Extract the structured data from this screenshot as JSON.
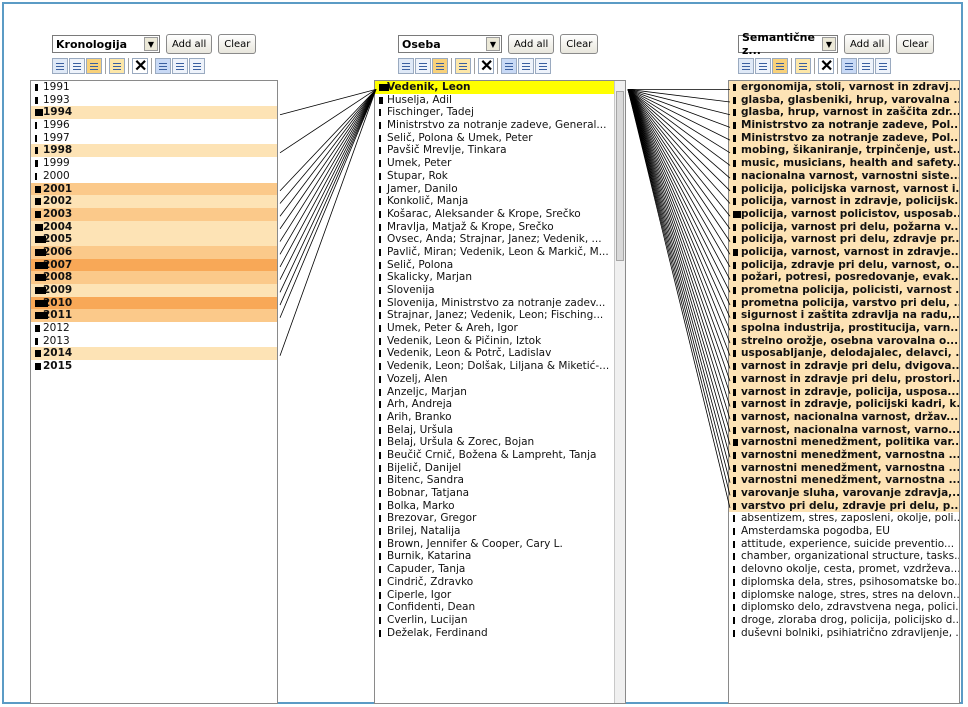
{
  "common": {
    "add_all": "Add all",
    "clear": "Clear"
  },
  "panels": [
    {
      "dropdown": "Kronologija"
    },
    {
      "dropdown": "Oseba"
    },
    {
      "dropdown": "Semantične z..."
    }
  ],
  "lists": {
    "years": [
      {
        "t": "1991",
        "w": 3,
        "h": ""
      },
      {
        "t": "1993",
        "w": 3,
        "h": ""
      },
      {
        "t": "1994",
        "w": 8,
        "h": "hl1",
        "b": true
      },
      {
        "t": "1996",
        "w": 2,
        "h": ""
      },
      {
        "t": "1997",
        "w": 2,
        "h": ""
      },
      {
        "t": "1998",
        "w": 3,
        "h": "hl1",
        "b": true
      },
      {
        "t": "1999",
        "w": 3,
        "h": ""
      },
      {
        "t": "2000",
        "w": 2,
        "h": ""
      },
      {
        "t": "2001",
        "w": 6,
        "h": "hl2",
        "b": true
      },
      {
        "t": "2002",
        "w": 6,
        "h": "hl1",
        "b": true
      },
      {
        "t": "2003",
        "w": 6,
        "h": "hl2",
        "b": true
      },
      {
        "t": "2004",
        "w": 8,
        "h": "hl1",
        "b": true
      },
      {
        "t": "2005",
        "w": 11,
        "h": "hl1",
        "b": true
      },
      {
        "t": "2006",
        "w": 11,
        "h": "hl2",
        "b": true
      },
      {
        "t": "2007",
        "w": 13,
        "h": "hl3",
        "b": true
      },
      {
        "t": "2008",
        "w": 11,
        "h": "hl2",
        "b": true
      },
      {
        "t": "2009",
        "w": 11,
        "h": "hl1",
        "b": true
      },
      {
        "t": "2010",
        "w": 13,
        "h": "hl3",
        "b": true
      },
      {
        "t": "2011",
        "w": 13,
        "h": "hl2",
        "b": true
      },
      {
        "t": "2012",
        "w": 5,
        "h": ""
      },
      {
        "t": "2013",
        "w": 3,
        "h": ""
      },
      {
        "t": "2014",
        "w": 6,
        "h": "hl1",
        "b": true
      },
      {
        "t": "2015",
        "w": 6,
        "h": "",
        "b": true
      }
    ],
    "people": [
      {
        "t": "Vedenik, Leon",
        "w": 10,
        "h": "hlY",
        "b": true
      },
      {
        "t": "Huselja, Adil",
        "w": 4,
        "h": ""
      },
      {
        "t": "Fischinger, Tadej",
        "w": 2,
        "h": ""
      },
      {
        "t": "Ministrstvo za notranje zadeve, General...",
        "w": 2,
        "h": ""
      },
      {
        "t": "Selič, Polona & Umek, Peter",
        "w": 2,
        "h": ""
      },
      {
        "t": "Pavšič Mrevlje, Tinkara",
        "w": 2,
        "h": ""
      },
      {
        "t": "Umek, Peter",
        "w": 2,
        "h": ""
      },
      {
        "t": "Štupar, Rok",
        "w": 2,
        "h": ""
      },
      {
        "t": "Jamer, Danilo",
        "w": 2,
        "h": ""
      },
      {
        "t": "Konkolič, Manja",
        "w": 2,
        "h": ""
      },
      {
        "t": "Košarac, Aleksander & Krope, Srečko",
        "w": 2,
        "h": ""
      },
      {
        "t": "Mravlja, Matjaž & Krope, Srečko",
        "w": 2,
        "h": ""
      },
      {
        "t": "Ovsec, Anda; Strajnar, Janez; Vedenik, ...",
        "w": 2,
        "h": ""
      },
      {
        "t": "Pavlič, Miran; Vedenik, Leon & Markič, M...",
        "w": 2,
        "h": ""
      },
      {
        "t": "Selič, Polona",
        "w": 2,
        "h": ""
      },
      {
        "t": "Skalicky, Marjan",
        "w": 2,
        "h": ""
      },
      {
        "t": "Slovenija",
        "w": 2,
        "h": ""
      },
      {
        "t": "Slovenija, Ministrstvo za notranje zadev...",
        "w": 2,
        "h": ""
      },
      {
        "t": "Strajnar, Janez; Vedenik, Leon; Fisching...",
        "w": 2,
        "h": ""
      },
      {
        "t": "Umek, Peter & Areh, Igor",
        "w": 2,
        "h": ""
      },
      {
        "t": "Vedenik, Leon & Pičinin, Iztok",
        "w": 2,
        "h": ""
      },
      {
        "t": "Vedenik, Leon & Potrč, Ladislav",
        "w": 2,
        "h": ""
      },
      {
        "t": "Vedenik, Leon; Dolšak, Liljana & Miketić-...",
        "w": 2,
        "h": ""
      },
      {
        "t": "Vozelj, Alen",
        "w": 2,
        "h": ""
      },
      {
        "t": "Anzeljc, Marjan",
        "w": 2,
        "h": ""
      },
      {
        "t": "Arh, Andreja",
        "w": 2,
        "h": ""
      },
      {
        "t": "Arih, Branko",
        "w": 2,
        "h": ""
      },
      {
        "t": "Belaj, Uršula",
        "w": 2,
        "h": ""
      },
      {
        "t": "Belaj, Uršula & Zorec, Bojan",
        "w": 2,
        "h": ""
      },
      {
        "t": "Beučič Crnič, Božena & Lampreht, Tanja",
        "w": 2,
        "h": ""
      },
      {
        "t": "Bijelič, Danijel",
        "w": 2,
        "h": ""
      },
      {
        "t": "Bitenc, Sandra",
        "w": 2,
        "h": ""
      },
      {
        "t": "Bobnar, Tatjana",
        "w": 2,
        "h": ""
      },
      {
        "t": "Bolka, Marko",
        "w": 2,
        "h": ""
      },
      {
        "t": "Brezovar, Gregor",
        "w": 2,
        "h": ""
      },
      {
        "t": "Brilej, Natalija",
        "w": 2,
        "h": ""
      },
      {
        "t": "Brown, Jennifer & Cooper, Cary L.",
        "w": 2,
        "h": ""
      },
      {
        "t": "Burnik, Katarina",
        "w": 2,
        "h": ""
      },
      {
        "t": "Capuder, Tanja",
        "w": 2,
        "h": ""
      },
      {
        "t": "Cindrič, Zdravko",
        "w": 2,
        "h": ""
      },
      {
        "t": "Ciperle, Igor",
        "w": 2,
        "h": ""
      },
      {
        "t": "Confidenti, Dean",
        "w": 2,
        "h": ""
      },
      {
        "t": "Cverlin, Lucijan",
        "w": 2,
        "h": ""
      },
      {
        "t": "Deželak, Ferdinand",
        "w": 2,
        "h": ""
      }
    ],
    "topics": [
      {
        "t": "ergonomija, stoli, varnost in zdravj...",
        "w": 3,
        "h": "hl1",
        "b": true
      },
      {
        "t": "glasba, glasbeniki, hrup, varovalna ...",
        "w": 3,
        "h": "hl1",
        "b": true
      },
      {
        "t": "glasba, hrup, varnost in zaščita zdr...",
        "w": 3,
        "h": "hl1",
        "b": true
      },
      {
        "t": "Ministrstvo za notranje zadeve, Pol...",
        "w": 3,
        "h": "hl1",
        "b": true
      },
      {
        "t": "Ministrstvo za notranje zadeve, Pol...",
        "w": 3,
        "h": "hl1",
        "b": true
      },
      {
        "t": "mobing, šikaniranje, trpinčenje, ust...",
        "w": 3,
        "h": "hl1",
        "b": true
      },
      {
        "t": "music, musicians, health and safety...",
        "w": 3,
        "h": "hl1",
        "b": true
      },
      {
        "t": "nacionalna varnost, varnostni siste...",
        "w": 3,
        "h": "hl1",
        "b": true
      },
      {
        "t": "policija, policijska varnost, varnost i...",
        "w": 3,
        "h": "hl1",
        "b": true
      },
      {
        "t": "policija, varnost in zdravje, policijsk...",
        "w": 3,
        "h": "hl1",
        "b": true
      },
      {
        "t": "policija, varnost policistov, usposab...",
        "w": 8,
        "h": "hl1",
        "b": true
      },
      {
        "t": "policija, varnost pri delu, požarna v...",
        "w": 3,
        "h": "hl1",
        "b": true
      },
      {
        "t": "policija, varnost pri delu, zdravje pr...",
        "w": 3,
        "h": "hl1",
        "b": true
      },
      {
        "t": "policija, varnost, varnost in zdravje...",
        "w": 5,
        "h": "hl1",
        "b": true
      },
      {
        "t": "policija, zdravje pri delu, varnost, o...",
        "w": 3,
        "h": "hl1",
        "b": true
      },
      {
        "t": "požari, potresi, posredovanje, evak...",
        "w": 3,
        "h": "hl1",
        "b": true
      },
      {
        "t": "prometna policija, policisti, varnost ...",
        "w": 3,
        "h": "hl1",
        "b": true
      },
      {
        "t": "prometna policija, varstvo pri delu, ...",
        "w": 3,
        "h": "hl1",
        "b": true
      },
      {
        "t": "sigurnost i zaštita zdravlja na radu,...",
        "w": 3,
        "h": "hl1",
        "b": true
      },
      {
        "t": "spolna industrija, prostitucija, varn...",
        "w": 3,
        "h": "hl1",
        "b": true
      },
      {
        "t": "strelno orožje, osebna varovalna o...",
        "w": 3,
        "h": "hl1",
        "b": true
      },
      {
        "t": "usposabljanje, delodajalec, delavci, ...",
        "w": 3,
        "h": "hl1",
        "b": true
      },
      {
        "t": "varnost in zdravje pri delu, dvigova...",
        "w": 3,
        "h": "hl1",
        "b": true
      },
      {
        "t": "varnost in zdravje pri delu, prostori...",
        "w": 3,
        "h": "hl1",
        "b": true
      },
      {
        "t": "varnost in zdravje, policija, usposa...",
        "w": 3,
        "h": "hl1",
        "b": true
      },
      {
        "t": "varnost in zdravje, policijski kadri, k...",
        "w": 3,
        "h": "hl1",
        "b": true
      },
      {
        "t": "varnost, nacionalna varnost, držav...",
        "w": 3,
        "h": "hl1",
        "b": true
      },
      {
        "t": "varnost, nacionalna varnost, varno...",
        "w": 3,
        "h": "hl1",
        "b": true
      },
      {
        "t": "varnostni menedžment, politika var...",
        "w": 5,
        "h": "hl1",
        "b": true
      },
      {
        "t": "varnostni menedžment, varnostna ...",
        "w": 3,
        "h": "hl1",
        "b": true
      },
      {
        "t": "varnostni menedžment, varnostna ...",
        "w": 3,
        "h": "hl1",
        "b": true
      },
      {
        "t": "varnostni menedžment, varnostna ...",
        "w": 3,
        "h": "hl1",
        "b": true
      },
      {
        "t": "varovanje sluha, varovanje zdravja,...",
        "w": 3,
        "h": "hl1",
        "b": true
      },
      {
        "t": "varstvo pri delu, zdravje pri delu, p...",
        "w": 3,
        "h": "hl1",
        "b": true
      },
      {
        "t": "absentizem, stres, zaposleni, okolje, poli...",
        "w": 2,
        "h": ""
      },
      {
        "t": "Amsterdamska pogodba, EU",
        "w": 2,
        "h": ""
      },
      {
        "t": "attitude, experience, suicide preventio...",
        "w": 2,
        "h": ""
      },
      {
        "t": "chamber, organizational structure, tasks...",
        "w": 2,
        "h": ""
      },
      {
        "t": "delovno okolje, cesta, promet, vzdrževa...",
        "w": 2,
        "h": ""
      },
      {
        "t": "diplomska dela, stres, psihosomatske bo...",
        "w": 2,
        "h": ""
      },
      {
        "t": "diplomske naloge, stres, stres na delovn...",
        "w": 2,
        "h": ""
      },
      {
        "t": "diplomsko delo, zdravstvena nega, polici...",
        "w": 2,
        "h": ""
      },
      {
        "t": "droge, zloraba drog, policija, policijsko d...",
        "w": 2,
        "h": ""
      },
      {
        "t": "duševni bolniki, psihiatrično zdravljenje, ...",
        "w": 2,
        "h": ""
      }
    ]
  }
}
